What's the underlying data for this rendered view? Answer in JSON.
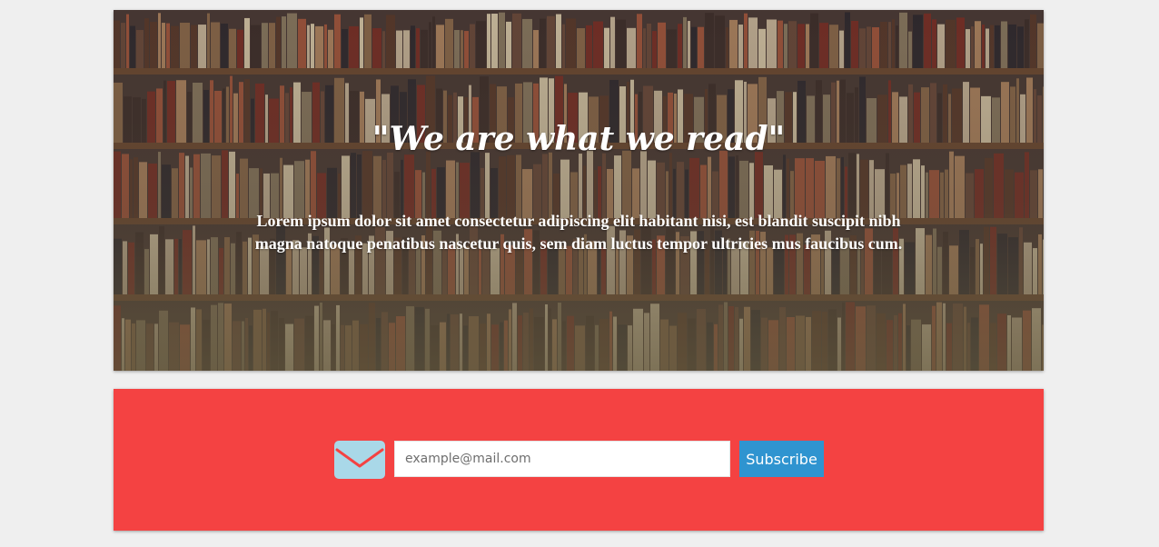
{
  "hero": {
    "title": "\"We are what we read\"",
    "text": "Lorem ipsum dolor sit amet consectetur adipiscing elit habitant nisi, est blandit suscipit nibh magna natoque penatibus nascetur quis, sem diam luctus tempor ultricies mus faucibus cum.",
    "background_image": "bookshelf-photo"
  },
  "subscribe": {
    "email_placeholder": "example@mail.com",
    "email_value": "",
    "button_label": "Subscribe",
    "icon": "mail-icon"
  },
  "colors": {
    "page_background": "#efefef",
    "panel_red": "#f44242",
    "button_blue": "#2f94d0",
    "icon_blue": "#a9d8e8"
  }
}
